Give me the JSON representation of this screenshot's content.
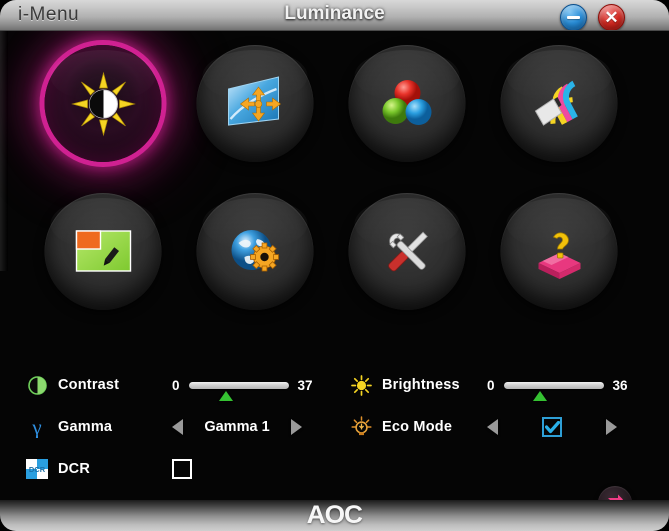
{
  "titlebar": {
    "app_name": "i-Menu",
    "window_title": "Luminance",
    "minimize_icon": "minimize-icon",
    "close_icon": "close-icon",
    "close_glyph": "✕",
    "minimize_color": "#2a8ed8",
    "close_color": "#d42a22"
  },
  "menu": {
    "selected_index": 0,
    "selection_color": "#d62396",
    "items": [
      {
        "name": "luminance",
        "icon": "sun-contrast-icon",
        "selected": true
      },
      {
        "name": "image-setup",
        "icon": "screen-arrows-icon",
        "selected": false
      },
      {
        "name": "color-setup",
        "icon": "rgb-spheres-icon",
        "selected": false
      },
      {
        "name": "picture-boost",
        "icon": "rainbow-card-icon",
        "selected": false
      },
      {
        "name": "osd-setup",
        "icon": "screen-pen-icon",
        "selected": false
      },
      {
        "name": "language-setup",
        "icon": "globe-gear-icon",
        "selected": false
      },
      {
        "name": "extra",
        "icon": "wrench-screwdriver-icon",
        "selected": false
      },
      {
        "name": "help",
        "icon": "book-question-icon",
        "selected": false
      }
    ]
  },
  "controls": {
    "contrast": {
      "icon": "contrast-circle-icon",
      "label": "Contrast",
      "min": "0",
      "max": "37",
      "value_percent": 37,
      "thumb_color": "#35c232"
    },
    "brightness": {
      "icon": "sun-icon",
      "label": "Brightness",
      "min": "0",
      "max": "36",
      "value_percent": 36,
      "thumb_color": "#35c232"
    },
    "gamma": {
      "icon": "gamma-icon",
      "label": "Gamma",
      "value": "Gamma 1",
      "left_arrow_icon": "arrow-left-icon",
      "right_arrow_icon": "arrow-right-icon"
    },
    "eco_mode": {
      "icon": "eco-bulb-icon",
      "label": "Eco Mode",
      "checked": true,
      "check_color": "#2e9fd6",
      "left_arrow_icon": "arrow-left-icon",
      "right_arrow_icon": "arrow-right-icon"
    },
    "dcr": {
      "icon": "dcr-icon",
      "label": "DCR",
      "checked": false
    }
  },
  "reset": {
    "icon": "reset-arrows-icon",
    "color": "#ef3d86"
  },
  "footer": {
    "logo": "AOC"
  }
}
